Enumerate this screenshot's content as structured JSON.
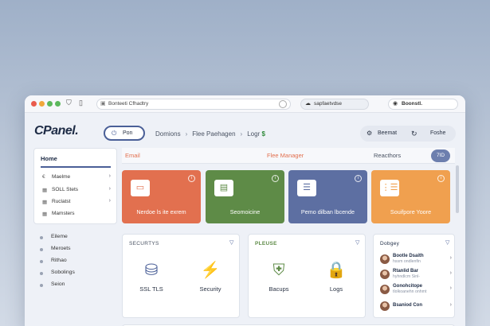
{
  "browser": {
    "address": "Bonteeti Cfhadtry",
    "tab_chip": "sapfaetvdse",
    "account_chip": "Boonstl."
  },
  "header": {
    "logo": "CPanel.",
    "toggle_label": "Pon",
    "breadcrumbs": [
      "Domions",
      "Flee Paehagen",
      "Logr"
    ],
    "breadcrumb_suffix": "$",
    "right_btn_1": "Beemat",
    "right_btn_2": "Foshe"
  },
  "left_nav": {
    "title": "Home",
    "items": [
      {
        "icon": "€",
        "label": "Maelme"
      },
      {
        "icon": "▦",
        "label": "SOLL Stets"
      },
      {
        "icon": "▦",
        "label": "Ruclatst"
      },
      {
        "icon": "▦",
        "label": "Mamsters"
      }
    ]
  },
  "left_list": [
    "Eileme",
    "Meroets",
    "Rithao",
    "Sobolings",
    "Seion"
  ],
  "main": {
    "tabs": [
      "Email",
      "Flee Manager",
      "Reacthors"
    ],
    "help": "7ID",
    "cards": [
      {
        "label": "Nerdoe ls ite exrem",
        "color": "#e2704f",
        "icon": "▭"
      },
      {
        "label": "Seomoicine",
        "color": "#5e8b47",
        "icon": "▤"
      },
      {
        "label": "Pemo dilban lbcende",
        "color": "#5d6fa2",
        "icon": "☰"
      },
      {
        "label": "Souifpore Yoore",
        "color": "#f0a04f",
        "icon": "⋮☰"
      }
    ],
    "security": {
      "title": "SECURTYS",
      "items": [
        {
          "icon": "⛁",
          "label": "SSL TLS"
        },
        {
          "icon": "⚡",
          "label": "Security"
        }
      ]
    },
    "backup": {
      "title": "PLEUSE",
      "items": [
        {
          "icon": "⛨",
          "label": "Bacups"
        },
        {
          "icon": "🔒",
          "label": "Logs"
        }
      ]
    },
    "people": {
      "title": "Dobgey",
      "items": [
        {
          "name": "Bootle Dsaith",
          "sub": "hssm ondlenfin"
        },
        {
          "name": "Rtanlid Bar",
          "sub": "hyhndlcm Sinl-"
        },
        {
          "name": "Gonohcitope",
          "sub": "tlolkoanehn onhmt"
        },
        {
          "name": "Bsaniod Con",
          "sub": ""
        }
      ]
    }
  }
}
